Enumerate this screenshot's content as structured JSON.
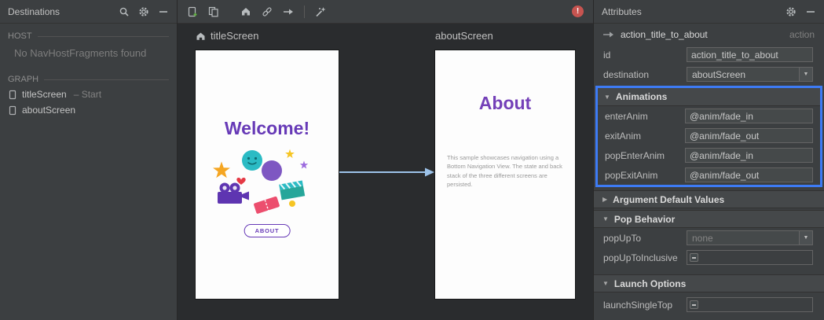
{
  "colors": {
    "accent_blue": "#3D7BF5",
    "purple": "#673AB7",
    "arrow_blue": "#9DC3EA",
    "error_red": "#C75450",
    "panel_bg": "#3c3f41",
    "canvas_bg": "#2a2c2e"
  },
  "icons": {
    "error_badge": "!",
    "expanded_triangle": "▼",
    "collapsed_triangle": "▶",
    "combo_arrow": "▼"
  },
  "destinations": {
    "title": "Destinations",
    "host_section": "HOST",
    "host_empty": "No NavHostFragments found",
    "graph_section": "GRAPH",
    "items": [
      {
        "label": "titleScreen",
        "suffix": "– Start"
      },
      {
        "label": "aboutScreen",
        "suffix": ""
      }
    ]
  },
  "canvas": {
    "title_screen": {
      "name": "titleScreen",
      "heading": "Welcome!",
      "button_label": "ABOUT"
    },
    "about_screen": {
      "name": "aboutScreen",
      "heading": "About",
      "body": "This sample showcases navigation using a Bottom Navigation View. The state and back stack of the three different screens are persisted."
    }
  },
  "attributes": {
    "title": "Attributes",
    "action": {
      "name": "action_title_to_about",
      "type": "action"
    },
    "id": {
      "label": "id",
      "value": "action_title_to_about"
    },
    "destination": {
      "label": "destination",
      "value": "aboutScreen"
    },
    "animations": {
      "header": "Animations",
      "rows": [
        {
          "label": "enterAnim",
          "value": "@anim/fade_in"
        },
        {
          "label": "exitAnim",
          "value": "@anim/fade_out"
        },
        {
          "label": "popEnterAnim",
          "value": "@anim/fade_in"
        },
        {
          "label": "popExitAnim",
          "value": "@anim/fade_out"
        }
      ]
    },
    "argument_defaults": {
      "header": "Argument Default Values"
    },
    "pop_behavior": {
      "header": "Pop Behavior",
      "pop_up_to": {
        "label": "popUpTo",
        "value": "none"
      },
      "pop_up_to_inclusive": {
        "label": "popUpToInclusive"
      }
    },
    "launch_options": {
      "header": "Launch Options",
      "launch_single_top": {
        "label": "launchSingleTop"
      }
    }
  }
}
